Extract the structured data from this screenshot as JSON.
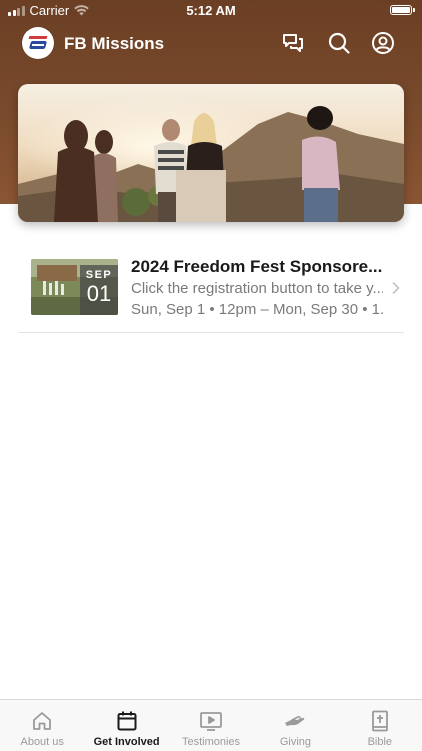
{
  "status_bar": {
    "carrier": "Carrier",
    "time": "5:12 AM"
  },
  "app_bar": {
    "title": "FB Missions"
  },
  "event": {
    "month": "SEP",
    "day": "01",
    "title": "2024 Freedom Fest Sponsore...",
    "description": "Click the registration button to take y...",
    "when": "Sun, Sep 1 • 12pm – Mon, Sep 30 • 1..."
  },
  "tabs": [
    {
      "label": "About us",
      "icon": "home-icon",
      "active": false
    },
    {
      "label": "Get Involved",
      "icon": "calendar-icon",
      "active": true
    },
    {
      "label": "Testimonies",
      "icon": "play-icon",
      "active": false
    },
    {
      "label": "Giving",
      "icon": "giving-hand-icon",
      "active": false
    },
    {
      "label": "Bible",
      "icon": "bible-icon",
      "active": false
    }
  ],
  "colors": {
    "header": "#7a4a2c",
    "tab_active": "#1a1a1a",
    "tab_inactive": "#9a9a9a"
  }
}
